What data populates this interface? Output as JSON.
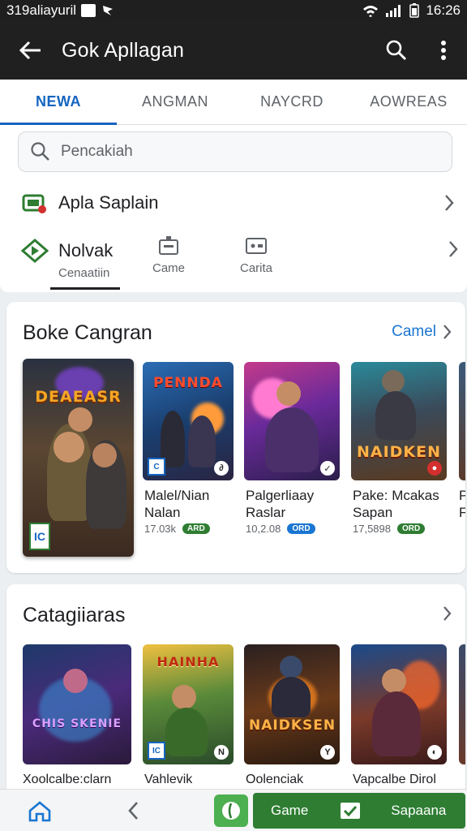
{
  "status_bar": {
    "left_text": "319aliayuril",
    "time": "16:26"
  },
  "app_bar": {
    "title": "Gok Apllagan",
    "back_icon": "arrow-left-icon",
    "search_icon": "search-icon",
    "menu_icon": "more-vert-icon"
  },
  "tabs": [
    {
      "label": "NEWA",
      "active": true
    },
    {
      "label": "ANGMAN",
      "active": false
    },
    {
      "label": "NAYCRD",
      "active": false
    },
    {
      "label": "AOWREAS",
      "active": false
    }
  ],
  "search": {
    "placeholder": "Pencakiah"
  },
  "apps_row": {
    "label": "Apla Saplain"
  },
  "filter_row": {
    "name": "Nolvak",
    "sub": "Cenaatiin",
    "items": [
      {
        "label": "Came"
      },
      {
        "label": "Carita"
      }
    ]
  },
  "section_1": {
    "title": "Boke Cangran",
    "more_label": "Camel",
    "featured": {
      "banner": "DEAEASR"
    },
    "cards": [
      {
        "banner": "PENNDA",
        "title_line1": "Malel/Nian",
        "title_line2": "Nalan",
        "meta": "17.03k",
        "pill": "ARD",
        "pill_color": "#2e7d32"
      },
      {
        "banner": "",
        "title_line1": "Palgerliaay",
        "title_line2": "Raslar",
        "meta": "10,2.08",
        "pill": "ORD",
        "pill_color": "#1976d2"
      },
      {
        "banner": "NAIDKEN",
        "title_line1": "Pake: Mcakas",
        "title_line2": "Sapan",
        "meta": "17,5898",
        "pill": "ORD",
        "pill_color": "#2e7d32"
      }
    ],
    "partial_card": {
      "title_line1": "P",
      "title_line2": "F"
    }
  },
  "section_2": {
    "title": "Catagiiaras",
    "cards": [
      {
        "banner": "CHIS SKENIE",
        "title": "Xoolcalbe:clarn"
      },
      {
        "banner": "HAINHA",
        "title": "Vahlevik"
      },
      {
        "banner": "NAIDKSEN",
        "title": "Oolenciak"
      },
      {
        "banner": "",
        "title": "Vapcalbe Dirol"
      }
    ]
  },
  "bottom_bar": {
    "home_icon": "home-icon",
    "back_icon": "chevron-left-icon",
    "game_label": "Game",
    "sapanna_label": "Sapaana"
  }
}
